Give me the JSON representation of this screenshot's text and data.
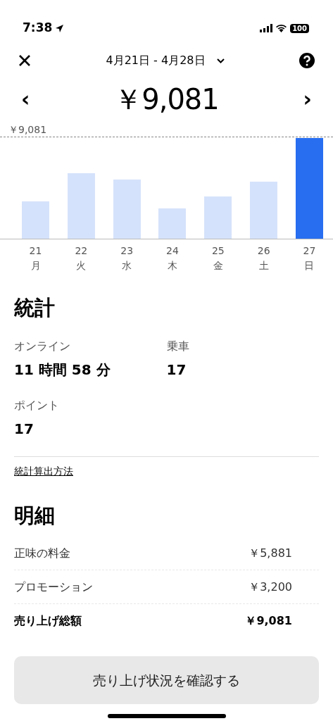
{
  "status_bar": {
    "time": "7:38",
    "battery": "100"
  },
  "header": {
    "date_range": "4月21日 - 4月28日"
  },
  "total": {
    "prev": "‹",
    "amount": "￥9,081",
    "next": "›"
  },
  "chart": {
    "max_label": "￥9,081",
    "days": [
      {
        "date": "21",
        "weekday": "月",
        "selected": false
      },
      {
        "date": "22",
        "weekday": "火",
        "selected": false
      },
      {
        "date": "23",
        "weekday": "水",
        "selected": false
      },
      {
        "date": "24",
        "weekday": "木",
        "selected": false
      },
      {
        "date": "25",
        "weekday": "金",
        "selected": false
      },
      {
        "date": "26",
        "weekday": "土",
        "selected": false
      },
      {
        "date": "27",
        "weekday": "日",
        "selected": true
      }
    ]
  },
  "stats": {
    "title": "統計",
    "items": [
      {
        "label": "オンライン",
        "value": "11 時間 58 分"
      },
      {
        "label": "乗車",
        "value": "17"
      },
      {
        "label": "ポイント",
        "value": "17"
      }
    ],
    "link": "統計算出方法"
  },
  "details": {
    "title": "明細",
    "rows": [
      {
        "label": "正味の料金",
        "amount": "￥5,881",
        "bold": false
      },
      {
        "label": "プロモーション",
        "amount": "￥3,200",
        "bold": false
      },
      {
        "label": "売り上げ総額",
        "amount": "￥9,081",
        "bold": true
      }
    ]
  },
  "button": "売り上げ状況を確認する"
}
